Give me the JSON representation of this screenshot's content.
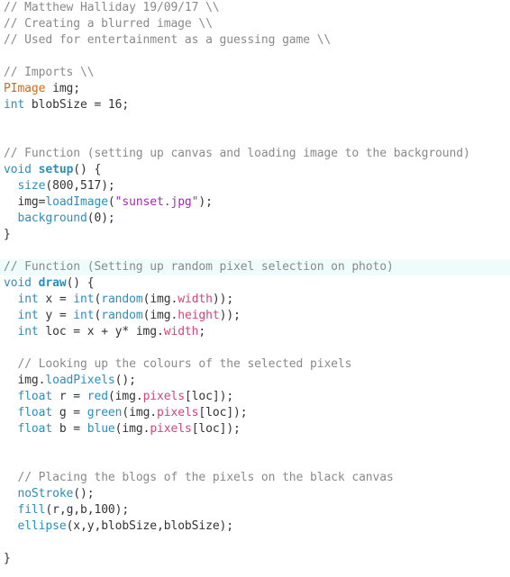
{
  "editor": {
    "highlight_line": 16,
    "colors": {
      "comment": "#8a8a8a",
      "type": "#d36a1b",
      "keyword": "#2a8fc0",
      "string": "#a12bb0",
      "property": "#d4457a",
      "plain": "#333333",
      "highlight_bg": "#eefcfc"
    },
    "lines": [
      [
        [
          "comment",
          "// Matthew Halliday 19/09/17 \\\\"
        ]
      ],
      [
        [
          "comment",
          "// Creating a blurred image \\\\"
        ]
      ],
      [
        [
          "comment",
          "// Used for entertainment as a guessing game \\\\"
        ]
      ],
      [],
      [
        [
          "comment",
          "// Imports \\\\"
        ]
      ],
      [
        [
          "type",
          "PImage"
        ],
        [
          "plain",
          " img;"
        ]
      ],
      [
        [
          "keyword",
          "int"
        ],
        [
          "plain",
          " blobSize = 16;"
        ]
      ],
      [],
      [],
      [
        [
          "comment",
          "// Function (setting up canvas and loading image to the background)"
        ]
      ],
      [
        [
          "keyword",
          "void"
        ],
        [
          "plain",
          " "
        ],
        [
          "fn",
          "setup"
        ],
        [
          "plain",
          "() {"
        ]
      ],
      [
        [
          "plain",
          "  "
        ],
        [
          "builtin",
          "size"
        ],
        [
          "plain",
          "(800,517);"
        ]
      ],
      [
        [
          "plain",
          "  img="
        ],
        [
          "builtin",
          "loadImage"
        ],
        [
          "plain",
          "("
        ],
        [
          "string",
          "\"sunset.jpg\""
        ],
        [
          "plain",
          ");"
        ]
      ],
      [
        [
          "plain",
          "  "
        ],
        [
          "builtin",
          "background"
        ],
        [
          "plain",
          "(0);"
        ]
      ],
      [
        [
          "plain",
          "}"
        ]
      ],
      [],
      [
        [
          "comment",
          "// Function (Setting up random pixel selection on photo)"
        ]
      ],
      [
        [
          "keyword",
          "void"
        ],
        [
          "plain",
          " "
        ],
        [
          "fn",
          "draw"
        ],
        [
          "plain",
          "() {"
        ]
      ],
      [
        [
          "plain",
          "  "
        ],
        [
          "keyword",
          "int"
        ],
        [
          "plain",
          " x = "
        ],
        [
          "builtin",
          "int"
        ],
        [
          "plain",
          "("
        ],
        [
          "builtin",
          "random"
        ],
        [
          "plain",
          "(img."
        ],
        [
          "prop",
          "width"
        ],
        [
          "plain",
          "));"
        ]
      ],
      [
        [
          "plain",
          "  "
        ],
        [
          "keyword",
          "int"
        ],
        [
          "plain",
          " y = "
        ],
        [
          "builtin",
          "int"
        ],
        [
          "plain",
          "("
        ],
        [
          "builtin",
          "random"
        ],
        [
          "plain",
          "(img."
        ],
        [
          "prop",
          "height"
        ],
        [
          "plain",
          "));"
        ]
      ],
      [
        [
          "plain",
          "  "
        ],
        [
          "keyword",
          "int"
        ],
        [
          "plain",
          " loc = x + y* img."
        ],
        [
          "prop",
          "width"
        ],
        [
          "plain",
          ";"
        ]
      ],
      [],
      [
        [
          "plain",
          "  "
        ],
        [
          "comment",
          "// Looking up the colours of the selected pixels"
        ]
      ],
      [
        [
          "plain",
          "  img."
        ],
        [
          "builtin",
          "loadPixels"
        ],
        [
          "plain",
          "();"
        ]
      ],
      [
        [
          "plain",
          "  "
        ],
        [
          "keyword",
          "float"
        ],
        [
          "plain",
          " r = "
        ],
        [
          "builtin",
          "red"
        ],
        [
          "plain",
          "(img."
        ],
        [
          "prop",
          "pixels"
        ],
        [
          "plain",
          "[loc]);"
        ]
      ],
      [
        [
          "plain",
          "  "
        ],
        [
          "keyword",
          "float"
        ],
        [
          "plain",
          " g = "
        ],
        [
          "builtin",
          "green"
        ],
        [
          "plain",
          "(img."
        ],
        [
          "prop",
          "pixels"
        ],
        [
          "plain",
          "[loc]);"
        ]
      ],
      [
        [
          "plain",
          "  "
        ],
        [
          "keyword",
          "float"
        ],
        [
          "plain",
          " b = "
        ],
        [
          "builtin",
          "blue"
        ],
        [
          "plain",
          "(img."
        ],
        [
          "prop",
          "pixels"
        ],
        [
          "plain",
          "[loc]);"
        ]
      ],
      [],
      [],
      [
        [
          "plain",
          "  "
        ],
        [
          "comment",
          "// Placing the blogs of the pixels on the black canvas"
        ]
      ],
      [
        [
          "plain",
          "  "
        ],
        [
          "builtin",
          "noStroke"
        ],
        [
          "plain",
          "();"
        ]
      ],
      [
        [
          "plain",
          "  "
        ],
        [
          "builtin",
          "fill"
        ],
        [
          "plain",
          "(r,g,b,100);"
        ]
      ],
      [
        [
          "plain",
          "  "
        ],
        [
          "builtin",
          "ellipse"
        ],
        [
          "plain",
          "(x,y,blobSize,blobSize);"
        ]
      ],
      [],
      [
        [
          "plain",
          "}"
        ]
      ]
    ]
  }
}
